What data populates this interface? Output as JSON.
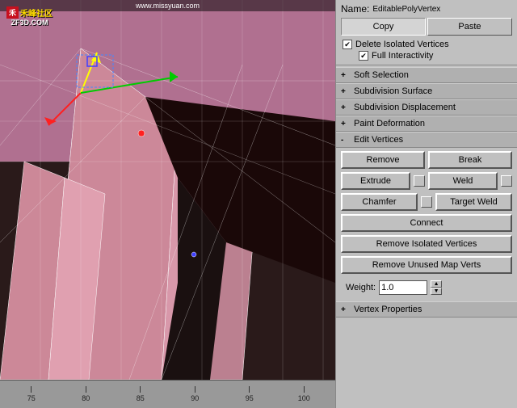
{
  "viewport": {
    "watermark": "www.missyuan.com",
    "logo_main": "禾峰社区",
    "logo_sub": "ZF3D.COM",
    "ruler_labels": [
      "75",
      "80",
      "85",
      "90",
      "95",
      "100"
    ]
  },
  "panel": {
    "name_label": "Name:",
    "name_value": "EditablePolyVertex",
    "copy_label": "Copy",
    "paste_label": "Paste",
    "delete_isolated_label": "Delete Isolated Vertices",
    "full_interactivity_label": "Full Interactivity",
    "sections": [
      {
        "toggle": "+",
        "title": "Soft Selection"
      },
      {
        "toggle": "+",
        "title": "Subdivision Surface"
      },
      {
        "toggle": "+",
        "title": "Subdivision Displacement"
      },
      {
        "toggle": "+",
        "title": "Paint Deformation"
      },
      {
        "toggle": "-",
        "title": "Edit Vertices"
      }
    ],
    "edit_vertices": {
      "remove_label": "Remove",
      "break_label": "Break",
      "extrude_label": "Extrude",
      "weld_label": "Weld",
      "chamfer_label": "Chamfer",
      "target_weld_label": "Target Weld",
      "connect_label": "Connect",
      "remove_isolated_label": "Remove Isolated Vertices",
      "remove_unused_label": "Remove Unused Map Verts",
      "weight_label": "Weight:",
      "weight_value": "1.0"
    },
    "vertex_props": {
      "toggle": "+",
      "title": "Vertex Properties"
    }
  }
}
